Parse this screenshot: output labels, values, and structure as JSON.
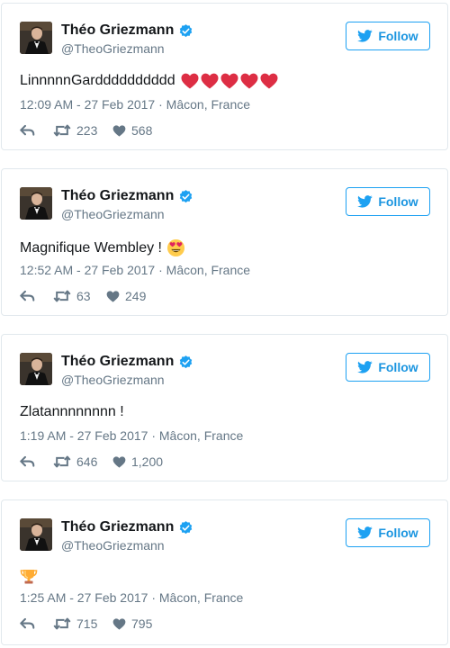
{
  "tweets": [
    {
      "name": "Théo Griezmann",
      "handle": "@TheoGriezmann",
      "follow_label": "Follow",
      "text": "LinnnnnGardddddddddd",
      "emoji": "heart-emoji x5",
      "timestamp": "12:09 AM - 27 Feb 2017",
      "location": "Mâcon, France",
      "retweets": "223",
      "likes": "568"
    },
    {
      "name": "Théo Griezmann",
      "handle": "@TheoGriezmann",
      "follow_label": "Follow",
      "text": "Magnifique Wembley !",
      "emoji": "heart-eyes-emoji",
      "timestamp": "12:52 AM - 27 Feb 2017",
      "location": "Mâcon, France",
      "retweets": "63",
      "likes": "249"
    },
    {
      "name": "Théo Griezmann",
      "handle": "@TheoGriezmann",
      "follow_label": "Follow",
      "text": "Zlatannnnnnnn !",
      "emoji": "",
      "timestamp": "1:19 AM - 27 Feb 2017",
      "location": "Mâcon, France",
      "retweets": "646",
      "likes": "1,200"
    },
    {
      "name": "Théo Griezmann",
      "handle": "@TheoGriezmann",
      "follow_label": "Follow",
      "text": "",
      "emoji": "trophy-emoji",
      "timestamp": "1:25 AM - 27 Feb 2017",
      "location": "Mâcon, France",
      "retweets": "715",
      "likes": "795"
    }
  ],
  "colors": {
    "accent": "#1da1f2",
    "follow_text": "#1b95e0",
    "meta_gray": "#657786",
    "heart_red": "#dd2e44",
    "border": "#e1e8ed"
  }
}
